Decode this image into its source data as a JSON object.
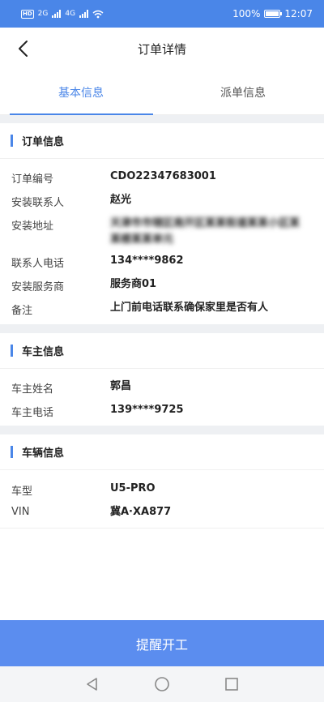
{
  "status_bar": {
    "network_left": "HD",
    "network_2": "2G",
    "network_4": "4G",
    "battery": "100%",
    "time": "12:07"
  },
  "nav": {
    "title": "订单详情"
  },
  "tabs": [
    {
      "label": "基本信息",
      "active": true
    },
    {
      "label": "派单信息",
      "active": false
    }
  ],
  "order_info": {
    "title": "订单信息",
    "rows": [
      {
        "label": "订单编号",
        "value": "CDO22347683001"
      },
      {
        "label": "安装联系人",
        "value": "赵光"
      },
      {
        "label": "安装地址",
        "value": "天津市市辖区南开区某某街道某某小区某某楼某某单元"
      },
      {
        "label": "联系人电话",
        "value": "134****9862"
      },
      {
        "label": "安装服务商",
        "value": "服务商01"
      },
      {
        "label": "备注",
        "value": "上门前电话联系确保家里是否有人"
      }
    ]
  },
  "owner_info": {
    "title": "车主信息",
    "rows": [
      {
        "label": "车主姓名",
        "value": "郭昌"
      },
      {
        "label": "车主电话",
        "value": "139****9725"
      }
    ]
  },
  "vehicle_info": {
    "title": "车辆信息",
    "rows": [
      {
        "label": "车型",
        "value": "U5-PRO"
      },
      {
        "label": "VIN",
        "value": "冀A·XA877"
      }
    ]
  },
  "cta": {
    "label": "提醒开工"
  },
  "colors": {
    "accent": "#4a86e8",
    "button": "#5b8def",
    "divider": "#eef0f3"
  },
  "icons": {
    "back": "chevron-left-icon",
    "sys_back": "triangle-back-icon",
    "sys_home": "circle-home-icon",
    "sys_recent": "square-recent-icon"
  }
}
